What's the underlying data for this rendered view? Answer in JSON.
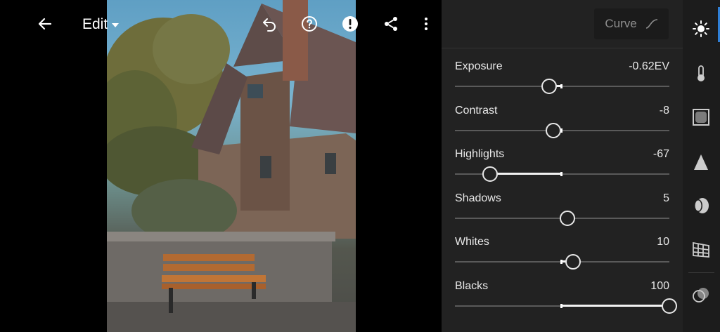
{
  "header": {
    "mode_label": "Edit",
    "icons": [
      "back-arrow-icon",
      "undo-icon",
      "help-icon",
      "alert-icon",
      "share-icon",
      "more-vertical-icon"
    ]
  },
  "panel": {
    "curve_label": "Curve",
    "sliders": [
      {
        "label": "Exposure",
        "value": "-0.62EV",
        "position": -0.62,
        "min": -5,
        "max": 5
      },
      {
        "label": "Contrast",
        "value": "-8",
        "position": -8,
        "min": -100,
        "max": 100
      },
      {
        "label": "Highlights",
        "value": "-67",
        "position": -67,
        "min": -100,
        "max": 100
      },
      {
        "label": "Shadows",
        "value": "5",
        "position": 5,
        "min": -100,
        "max": 100
      },
      {
        "label": "Whites",
        "value": "10",
        "position": 10,
        "min": -100,
        "max": 100
      },
      {
        "label": "Blacks",
        "value": "100",
        "position": 100,
        "min": -100,
        "max": 100
      }
    ]
  },
  "rail": {
    "tools": [
      "light-icon",
      "color-icon",
      "effects-icon",
      "detail-icon",
      "optics-icon",
      "geometry-icon",
      "presets-icon"
    ],
    "active": "light-icon",
    "accent_color": "#2f7fd6"
  }
}
